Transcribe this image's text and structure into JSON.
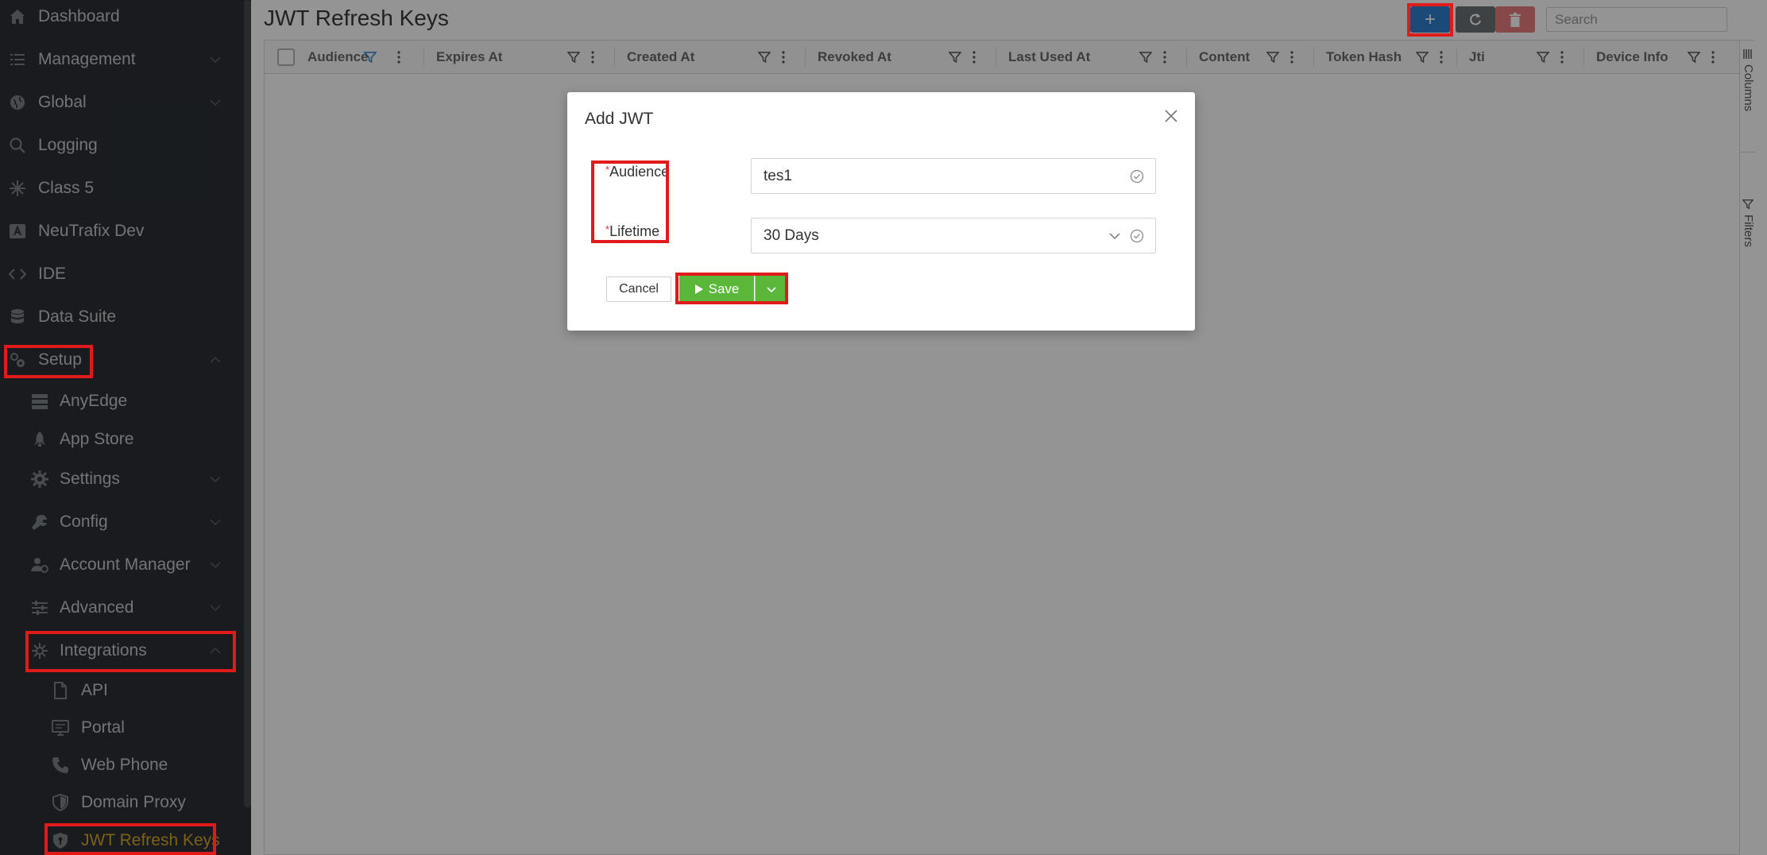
{
  "sidebar": {
    "items": [
      {
        "label": "Dashboard",
        "icon": "home-icon"
      },
      {
        "label": "Management",
        "icon": "list-icon"
      },
      {
        "label": "Global",
        "icon": "globe-icon"
      },
      {
        "label": "Logging",
        "icon": "search-icon"
      },
      {
        "label": "Class 5",
        "icon": "asterisk-icon"
      },
      {
        "label": "NeuTrafix Dev",
        "icon": "app-icon"
      },
      {
        "label": "IDE",
        "icon": "code-icon"
      },
      {
        "label": "Data Suite",
        "icon": "database-icon"
      },
      {
        "label": "Setup",
        "icon": "setup-gear-icon"
      },
      {
        "label": "AnyEdge",
        "icon": "server-icon"
      },
      {
        "label": "App Store",
        "icon": "rocket-icon"
      },
      {
        "label": "Settings",
        "icon": "gear-icon"
      },
      {
        "label": "Config",
        "icon": "wrench-icon"
      },
      {
        "label": "Account Manager",
        "icon": "user-gear-icon"
      },
      {
        "label": "Advanced",
        "icon": "sliders-icon"
      },
      {
        "label": "Integrations",
        "icon": "integrations-icon"
      },
      {
        "label": "API",
        "icon": "file-icon"
      },
      {
        "label": "Portal",
        "icon": "monitor-icon"
      },
      {
        "label": "Web Phone",
        "icon": "phone-icon"
      },
      {
        "label": "Domain Proxy",
        "icon": "shield-icon"
      },
      {
        "label": "JWT Refresh Keys",
        "icon": "shield-key-icon"
      }
    ]
  },
  "main": {
    "title": "JWT Refresh Keys",
    "toolbar": {
      "add_label": "+",
      "search_placeholder": "Search"
    },
    "grid": {
      "columns": [
        "Audience",
        "Expires At",
        "Created At",
        "Revoked At",
        "Last Used At",
        "Content",
        "Token Hash",
        "Jti",
        "Device Info"
      ]
    },
    "side_tools": {
      "columns_label": "Columns",
      "filters_label": "Filters"
    }
  },
  "modal": {
    "title": "Add JWT",
    "fields": {
      "audience": {
        "label": "Audience",
        "required_mark": "*",
        "value": "tes1"
      },
      "lifetime": {
        "label": "Lifetime",
        "required_mark": "*",
        "value": "30 Days"
      }
    },
    "buttons": {
      "cancel": "Cancel",
      "save": "Save"
    }
  },
  "colors": {
    "sidebar_bg": "#2b3034",
    "active_item": "#d4a72c",
    "add_button": "#2f80d1",
    "save_button": "#5ab73a",
    "highlight_box": "#e01b1b"
  }
}
